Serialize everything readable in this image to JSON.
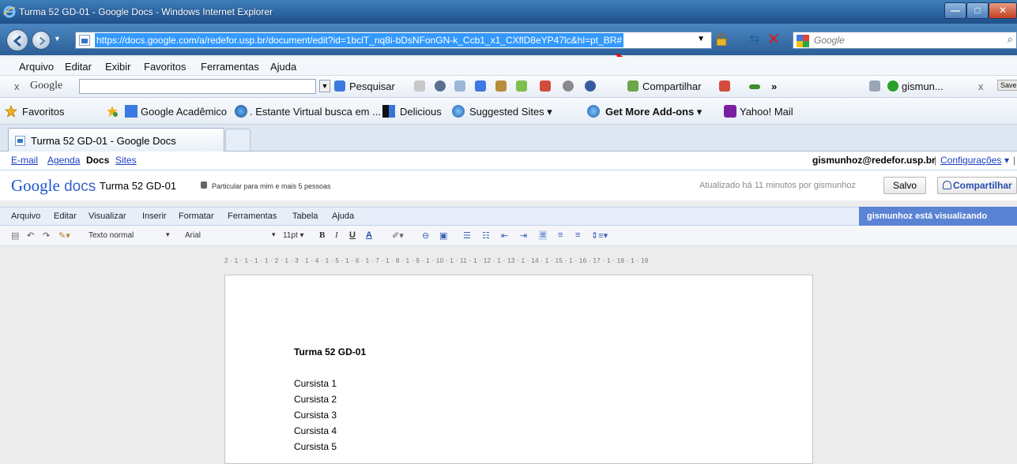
{
  "window": {
    "title": "Turma 52 GD-01 - Google Docs - Windows Internet Explorer",
    "min_label": "—",
    "max_label": "□",
    "close_label": "✕"
  },
  "address": {
    "url": "https://docs.google.com/a/redefor.usp.br/document/edit?id=1bclT_nq8i-bDsNFonGN-k_Ccb1_x1_CXflD8eYP47lc&hl=pt_BR#",
    "search_placeholder": "Google"
  },
  "menubar": [
    "Arquivo",
    "Editar",
    "Exibir",
    "Favoritos",
    "Ferramentas",
    "Ajuda"
  ],
  "google_toolbar": {
    "logo": "Google",
    "search_label": "Pesquisar",
    "share_label": "Compartilhar",
    "more": "»",
    "account": "gismun..."
  },
  "favorites": {
    "favorites_label": "Favoritos",
    "items": [
      "Google Acadêmico",
      ". Estante Virtual busca em ...",
      "Delicious",
      "Suggested Sites ▾",
      "Get More Add-ons ▾",
      "Yahoo! Mail"
    ]
  },
  "tab": {
    "label": "Turma 52 GD-01 - Google Docs"
  },
  "gbar": {
    "links": [
      "E-mail",
      "Agenda",
      "Docs",
      "Sites"
    ],
    "user": "gismunhoz@redefor.usp.br",
    "separator": "|",
    "settings": "Configurações",
    "settings_arrow": "▾",
    "help_sep": "|"
  },
  "docs_header": {
    "logo_google": "Google",
    "logo_docs": "docs",
    "doc_title": "Turma 52 GD-01",
    "privacy": "Particular para mim e mais 5 pessoas",
    "updated": "Atualizado há 11 minutos por gismunhoz",
    "save": "Salvo",
    "share": "Compartilhar"
  },
  "docs_menu": {
    "items": [
      "Arquivo",
      "Editar",
      "Visualizar",
      "Inserir",
      "Formatar",
      "Ferramentas",
      "Tabela",
      "Ajuda"
    ],
    "viewing": "gismunhoz está visualizando"
  },
  "format_toolbar": {
    "style": "Texto normal",
    "font": "Arial",
    "size": "11pt",
    "bold": "B",
    "italic": "I",
    "underline": "U",
    "textcolor": "A"
  },
  "ruler": "2 · 1 · 1 · 1 · 1 · 2 · 1 · 3 · 1 · 4 · 1 · 5 · 1 · 6 · 1 · 7 · 1 · 8 · 1 · 9 · 1 · 10 · 1 · 11 · 1 · 12 · 1 · 13 · 1 · 14 · 1 · 15 · 1 · 16 · 17 · 1 · 18 · 1 · 19",
  "document": {
    "heading": "Turma 52 GD-01",
    "lines": [
      "Cursista 1",
      "Cursista 2",
      "Cursista 3",
      "Cursista 4",
      "Cursista 5"
    ]
  },
  "colors": {
    "url_highlight": "#3399ff",
    "arrow": "#ff0000",
    "viewing_bg": "#5b83d4"
  }
}
